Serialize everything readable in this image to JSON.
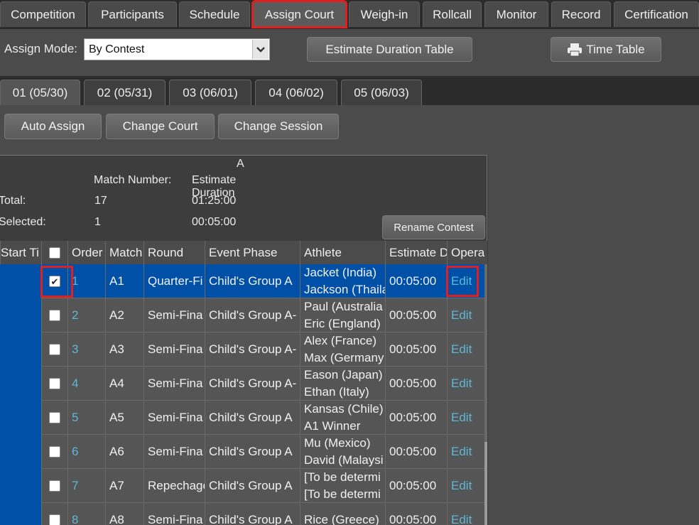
{
  "top_tabs": [
    "Competition",
    "Participants",
    "Schedule",
    "Assign Court",
    "Weigh-in",
    "Rollcall",
    "Monitor",
    "Record",
    "Certification"
  ],
  "assign_mode": {
    "label": "Assign Mode:",
    "value": "By Contest"
  },
  "buttons": {
    "estimate": "Estimate Duration Table",
    "timetable": "Time Table",
    "auto_assign": "Auto Assign",
    "change_court": "Change Court",
    "change_session": "Change Session",
    "rename_contest": "Rename Contest"
  },
  "day_tabs": [
    "01 (05/30)",
    "02 (05/31)",
    "03 (06/01)",
    "04 (06/02)",
    "05 (06/03)"
  ],
  "summary": {
    "court": "A",
    "match_number_label": "Match Number:",
    "estimate_label": "Estimate Duration",
    "total_label": "Total:",
    "total_matches": "17",
    "total_duration": "01:25:00",
    "selected_label": "Selected:",
    "selected_matches": "1",
    "selected_duration": "00:05:00"
  },
  "columns": [
    "Start Ti",
    "Order",
    "Match",
    "Round",
    "Event Phase",
    "Athlete",
    "Estimate D",
    "Opera"
  ],
  "rows": [
    {
      "checked": true,
      "order": "1",
      "match": "A1",
      "round": "Quarter-Fi",
      "phase": "Child's Group A",
      "athlete1": "Jacket (India)",
      "athlete2": "Jackson (Thaila",
      "duration": "00:05:00",
      "op": "Edit"
    },
    {
      "checked": false,
      "order": "2",
      "match": "A2",
      "round": "Semi-Fina",
      "phase": "Child's Group A-",
      "athlete1": "Paul (Australia",
      "athlete2": "Eric (England)",
      "duration": "00:05:00",
      "op": "Edit"
    },
    {
      "checked": false,
      "order": "3",
      "match": "A3",
      "round": "Semi-Fina",
      "phase": "Child's Group A-",
      "athlete1": "Alex (France)",
      "athlete2": "Max (Germany",
      "duration": "00:05:00",
      "op": "Edit"
    },
    {
      "checked": false,
      "order": "4",
      "match": "A4",
      "round": "Semi-Fina",
      "phase": "Child's Group A-",
      "athlete1": "Eason (Japan)",
      "athlete2": "Ethan (Italy)",
      "duration": "00:05:00",
      "op": "Edit"
    },
    {
      "checked": false,
      "order": "5",
      "match": "A5",
      "round": "Semi-Fina",
      "phase": "Child's Group A",
      "athlete1": "Kansas (Chile)",
      "athlete2": "A1 Winner",
      "duration": "00:05:00",
      "op": "Edit"
    },
    {
      "checked": false,
      "order": "6",
      "match": "A6",
      "round": "Semi-Fina",
      "phase": "Child's Group A",
      "athlete1": "Mu (Mexico)",
      "athlete2": "David (Malaysi",
      "duration": "00:05:00",
      "op": "Edit"
    },
    {
      "checked": false,
      "order": "7",
      "match": "A7",
      "round": "Repechage",
      "phase": "Child's Group A",
      "athlete1": "[To be determi",
      "athlete2": "[To be determi",
      "duration": "00:05:00",
      "op": "Edit"
    },
    {
      "checked": false,
      "order": "8",
      "match": "A8",
      "round": "Semi-Fina",
      "phase": "Child's Group A",
      "athlete1": "Rice (Greece)",
      "athlete2": "",
      "duration": "00:05:00",
      "op": "Edit"
    }
  ]
}
